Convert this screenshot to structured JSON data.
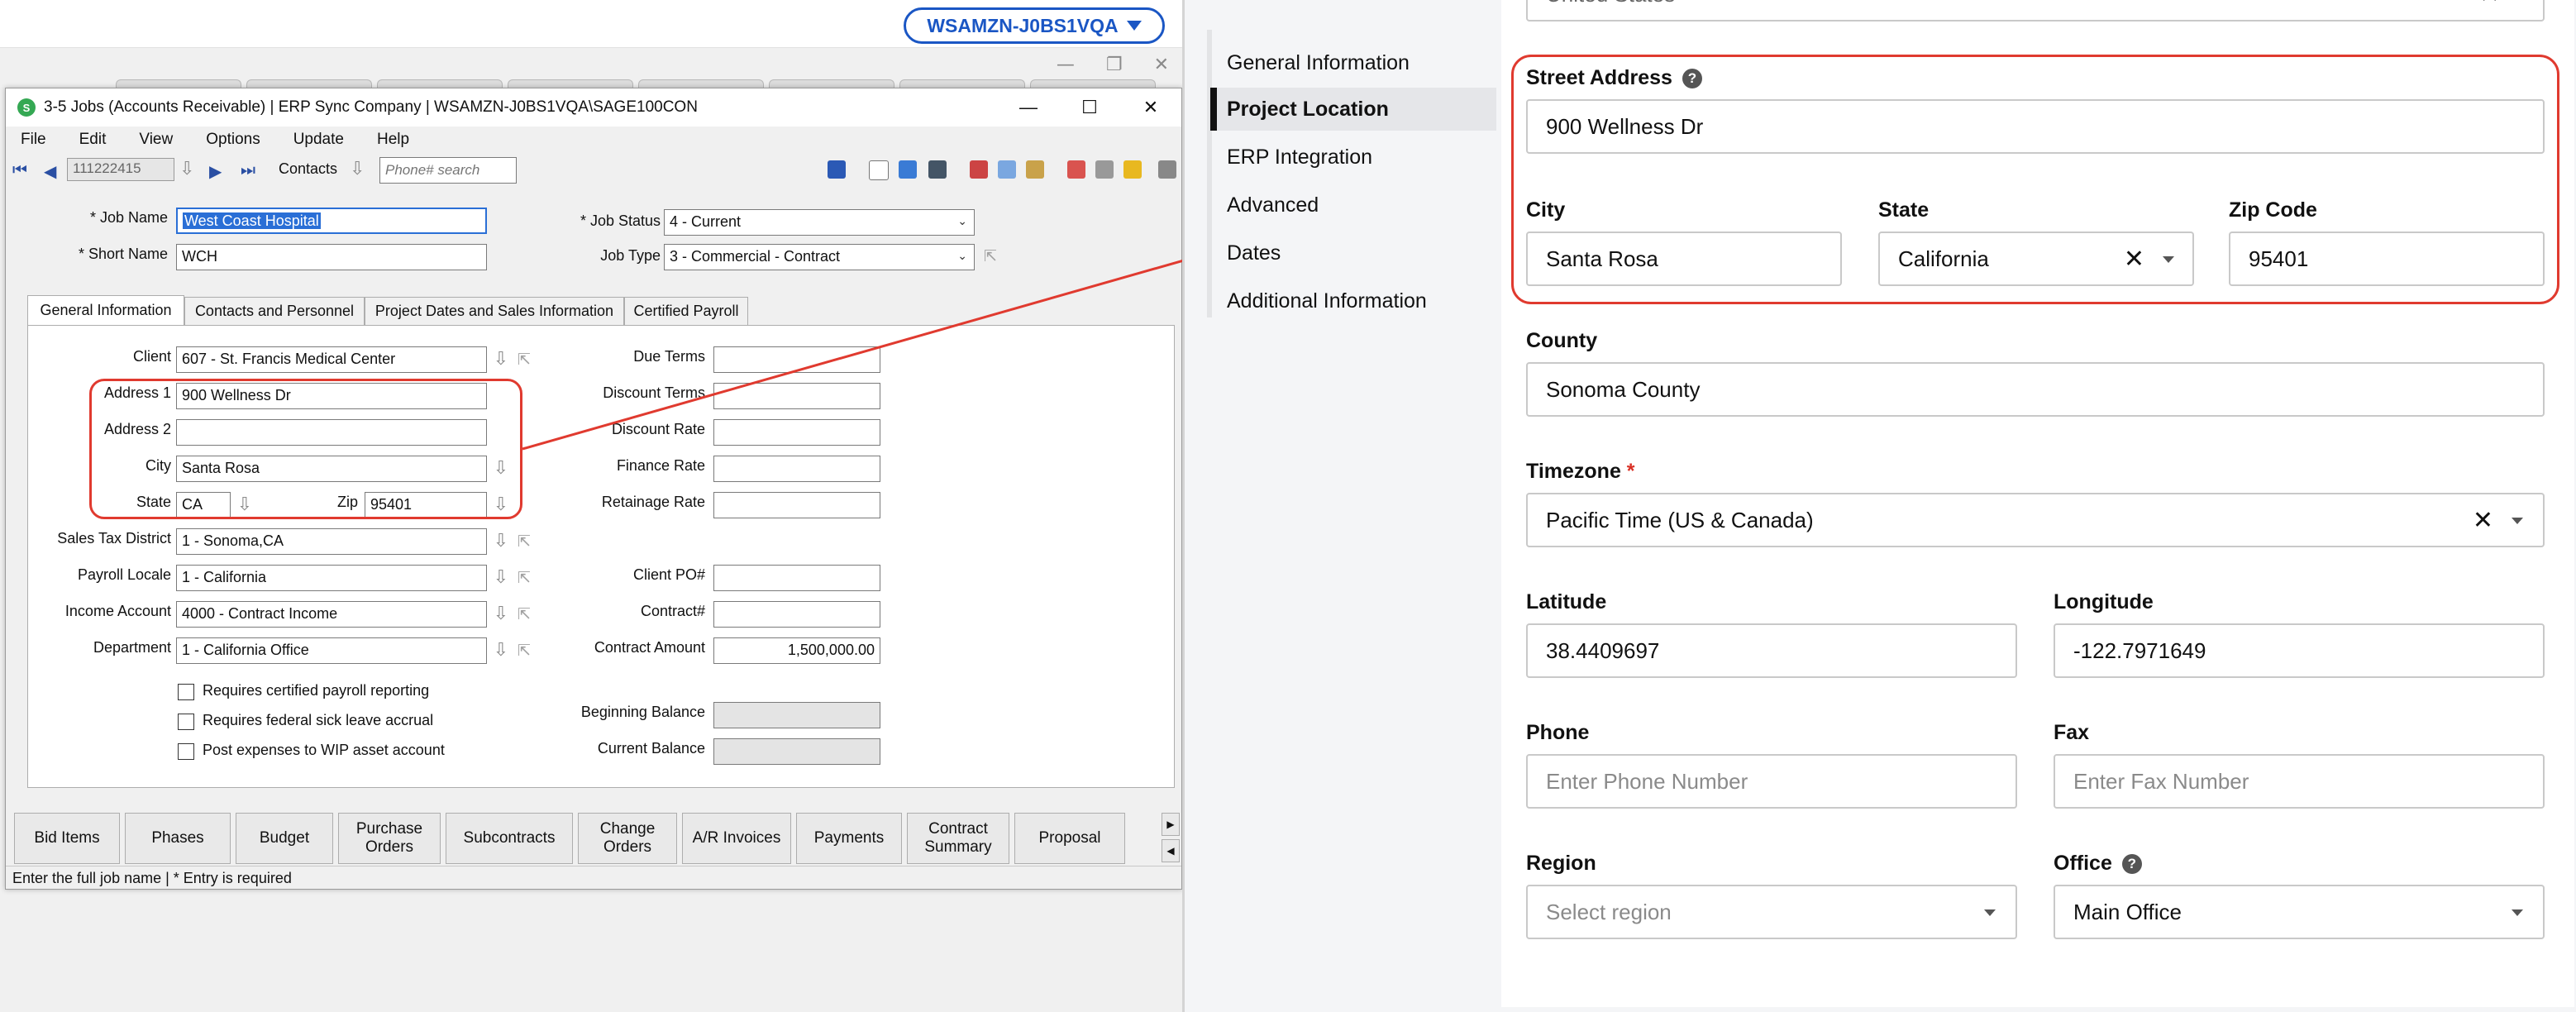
{
  "remote": {
    "machine_label": "WSAMZN-J0BS1VQA"
  },
  "window": {
    "title": "3-5 Jobs (Accounts Receivable) | ERP Sync Company | WSAMZN-J0BS1VQA\\SAGE100CON",
    "controls": {
      "minimize": "—",
      "maximize": "☐",
      "close": "✕"
    }
  },
  "menu": [
    "File",
    "Edit",
    "View",
    "Options",
    "Update",
    "Help"
  ],
  "toolbar": {
    "record": "111222415",
    "contacts_label": "Contacts",
    "phone_placeholder": "Phone# search"
  },
  "job": {
    "job_name_label": "* Job Name",
    "job_name": "West Coast Hospital",
    "short_name_label": "* Short Name",
    "short_name": "WCH",
    "job_status_label": "* Job Status",
    "job_status": "4 - Current",
    "job_type_label": "Job Type",
    "job_type": "3 - Commercial - Contract"
  },
  "tabs": [
    "General Information",
    "Contacts and Personnel",
    "Project Dates and Sales Information",
    "Certified Payroll"
  ],
  "general": {
    "client_label": "Client",
    "client": "607 - St. Francis Medical Center",
    "address1_label": "Address 1",
    "address1": "900 Wellness Dr",
    "address2_label": "Address 2",
    "address2": "",
    "city_label": "City",
    "city": "Santa Rosa",
    "state_label": "State",
    "state": "CA",
    "zip_label": "Zip",
    "zip": "95401",
    "sales_tax_label": "Sales Tax District",
    "sales_tax": "1 - Sonoma,CA",
    "payroll_label": "Payroll Locale",
    "payroll": "1 - California",
    "income_label": "Income Account",
    "income": "4000 - Contract Income",
    "department_label": "Department",
    "department": "1 - California Office",
    "due_terms_label": "Due Terms",
    "discount_terms_label": "Discount Terms",
    "discount_rate_label": "Discount Rate",
    "finance_rate_label": "Finance Rate",
    "retainage_rate_label": "Retainage Rate",
    "client_po_label": "Client PO#",
    "contract_label": "Contract#",
    "contract_amount_label": "Contract Amount",
    "contract_amount": "1,500,000.00",
    "beginning_balance_label": "Beginning Balance",
    "current_balance_label": "Current Balance",
    "chk_certified": "Requires certified payroll reporting",
    "chk_sick": "Requires federal sick leave accrual",
    "chk_wip": "Post expenses to WIP asset account"
  },
  "bottom_buttons": [
    "Bid Items",
    "Phases",
    "Budget",
    "Purchase Orders",
    "Subcontracts",
    "Change Orders",
    "A/R Invoices",
    "Payments",
    "Contract Summary",
    "Proposal"
  ],
  "statusbar": "Enter the full job name  |  * Entry is required",
  "nav": {
    "items": [
      "General Information",
      "Project Location",
      "ERP Integration",
      "Advanced",
      "Dates",
      "Additional Information"
    ],
    "active_index": 1
  },
  "form": {
    "country_value": "United States",
    "street_label": "Street Address",
    "street": "900 Wellness Dr",
    "city_label": "City",
    "city": "Santa Rosa",
    "state_label": "State",
    "state": "California",
    "zip_label": "Zip Code",
    "zip": "95401",
    "county_label": "County",
    "county": "Sonoma County",
    "timezone_label": "Timezone",
    "timezone_req": "*",
    "timezone": "Pacific Time (US & Canada)",
    "lat_label": "Latitude",
    "lat": "38.4409697",
    "lng_label": "Longitude",
    "lng": "-122.7971649",
    "phone_label": "Phone",
    "phone_placeholder": "Enter Phone Number",
    "fax_label": "Fax",
    "fax_placeholder": "Enter Fax Number",
    "region_label": "Region",
    "region_placeholder": "Select region",
    "office_label": "Office",
    "office": "Main Office"
  },
  "colors": {
    "annotation_red": "#e03a2f",
    "pill_blue": "#1a56c4",
    "selection_blue": "#2a6fd6"
  }
}
